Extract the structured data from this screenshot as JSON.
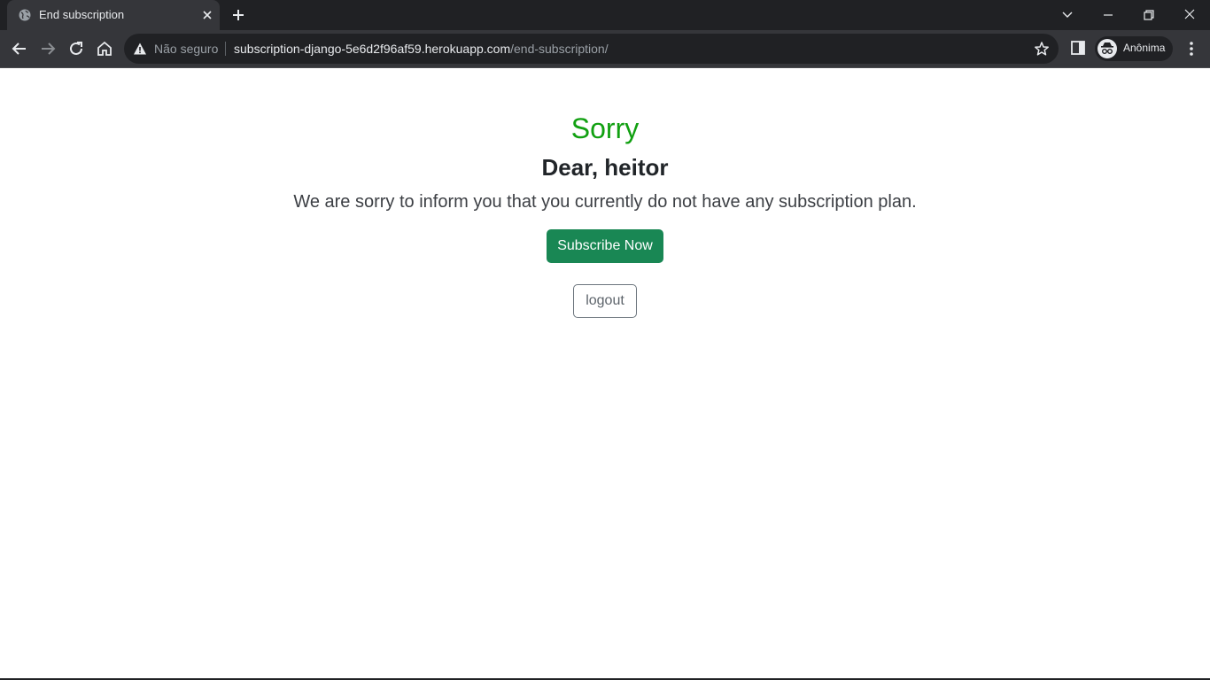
{
  "browser": {
    "tab": {
      "title": "End subscription"
    },
    "omnibox": {
      "security_label": "Não seguro",
      "url_host": "subscription-django-5e6d2f96af59.herokuapp.com",
      "url_path": "/end-subscription/"
    },
    "profile": {
      "label": "Anônima"
    }
  },
  "page": {
    "heading": "Sorry",
    "greeting": "Dear, heitor",
    "message": "We are sorry to inform you that you currently do not have any subscription plan.",
    "subscribe_label": "Subscribe Now",
    "logout_label": "logout"
  },
  "colors": {
    "heading": "#11a011",
    "subscribe_button": "#198754",
    "browser_chrome": "#202124"
  }
}
